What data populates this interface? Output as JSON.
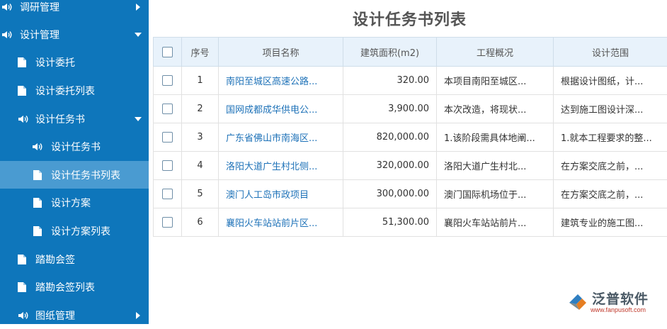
{
  "sidebar": {
    "items": [
      {
        "label": "调研管理",
        "icon": "speaker-icon",
        "caret": "right",
        "level": 0
      },
      {
        "label": "设计管理",
        "icon": "speaker-icon",
        "caret": "down",
        "level": 0
      },
      {
        "label": "设计委托",
        "icon": "document-icon",
        "caret": "",
        "level": 1
      },
      {
        "label": "设计委托列表",
        "icon": "document-icon",
        "caret": "",
        "level": 1
      },
      {
        "label": "设计任务书",
        "icon": "speaker-icon",
        "caret": "down",
        "level": 1
      },
      {
        "label": "设计任务书",
        "icon": "speaker-icon",
        "caret": "",
        "level": 2
      },
      {
        "label": "设计任务书列表",
        "icon": "document-icon",
        "caret": "",
        "level": 2,
        "active": true
      },
      {
        "label": "设计方案",
        "icon": "document-icon",
        "caret": "",
        "level": 2
      },
      {
        "label": "设计方案列表",
        "icon": "document-icon",
        "caret": "",
        "level": 2
      },
      {
        "label": "踏勘会签",
        "icon": "document-icon",
        "caret": "",
        "level": 1
      },
      {
        "label": "踏勘会签列表",
        "icon": "document-icon",
        "caret": "",
        "level": 1
      },
      {
        "label": "图纸管理",
        "icon": "speaker-icon",
        "caret": "right",
        "level": 0
      }
    ]
  },
  "main": {
    "title": "设计任务书列表",
    "columns": [
      "序号",
      "项目名称",
      "建筑面积(m2)",
      "工程概况",
      "设计范围"
    ],
    "rows": [
      {
        "no": "1",
        "name": "南阳至城区高速公路...",
        "area": "320.00",
        "overview": "本项目南阳至城区...",
        "scope": "根据设计图纸，计..."
      },
      {
        "no": "2",
        "name": "国网成都成华供电公...",
        "area": "3,900.00",
        "overview": "本次改造，将现状...",
        "scope": "达到施工图设计深..."
      },
      {
        "no": "3",
        "name": "广东省佛山市南海区...",
        "area": "820,000.00",
        "overview": "1.该阶段需具体地阐...",
        "scope": "1.就本工程要求的整..."
      },
      {
        "no": "4",
        "name": "洛阳大道广生村北侧...",
        "area": "320,000.00",
        "overview": "洛阳大道广生村北...",
        "scope": "在方案交底之前，..."
      },
      {
        "no": "5",
        "name": "澳门人工岛市政项目",
        "area": "300,000.00",
        "overview": "澳门国际机场位于...",
        "scope": "在方案交底之前，..."
      },
      {
        "no": "6",
        "name": "襄阳火车站站前片区...",
        "area": "51,300.00",
        "overview": "襄阳火车站站前片...",
        "scope": "建筑专业的施工图..."
      }
    ]
  },
  "watermark": {
    "text": "泛普软件",
    "url": "www.fanpusoft.com"
  },
  "colors": {
    "sidebar": "#0e76bb",
    "sidebar_active": "#4a9bd1",
    "header": "#e8f2fb",
    "link": "#1e72b8"
  }
}
